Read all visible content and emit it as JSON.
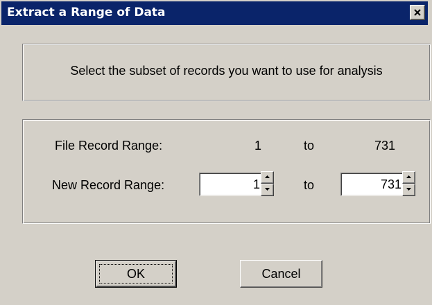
{
  "window": {
    "title": "Extract a Range of Data",
    "close_icon": "close-icon"
  },
  "instructions": {
    "text": "Select the subset of records you want to use for analysis"
  },
  "file_range": {
    "label": "File Record Range:",
    "start": "1",
    "to_label": "to",
    "end": "731"
  },
  "new_range": {
    "label": "New Record Range:",
    "start_value": "1",
    "to_label": "to",
    "end_value": "731"
  },
  "buttons": {
    "ok_label": "OK",
    "cancel_label": "Cancel"
  },
  "colors": {
    "titlebar": "#0a246a",
    "face": "#d4d0c8",
    "field": "#ffffff"
  }
}
